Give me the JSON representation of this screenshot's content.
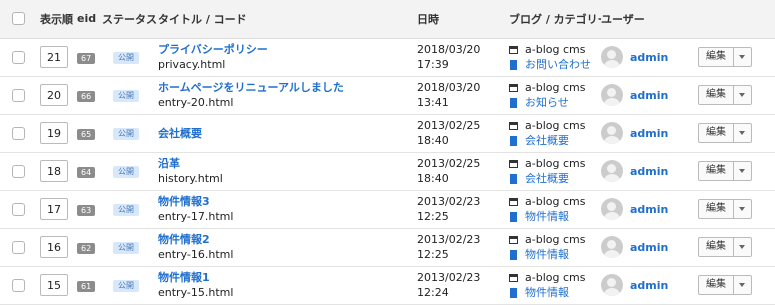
{
  "headers": {
    "order": "表示順",
    "eid": "eid",
    "status": "ステータス",
    "title": "タイトル / コード",
    "date": "日時",
    "blog": "ブログ / カテゴリー",
    "user": "ユーザー"
  },
  "rows": [
    {
      "order": "21",
      "eid": "67",
      "status": "公開",
      "title": "プライバシーポリシー",
      "code": "privacy.html",
      "date": "2018/03/20",
      "time": "17:39",
      "blog": "a-blog cms",
      "category": "お問い合わせ",
      "user": "admin",
      "edit": "編集"
    },
    {
      "order": "20",
      "eid": "66",
      "status": "公開",
      "title": "ホームページをリニューアルしました",
      "code": "entry-20.html",
      "date": "2018/03/20",
      "time": "13:41",
      "blog": "a-blog cms",
      "category": "お知らせ",
      "user": "admin",
      "edit": "編集"
    },
    {
      "order": "19",
      "eid": "65",
      "status": "公開",
      "title": "会社概要",
      "code": "",
      "date": "2013/02/25",
      "time": "18:40",
      "blog": "a-blog cms",
      "category": "会社概要",
      "user": "admin",
      "edit": "編集"
    },
    {
      "order": "18",
      "eid": "64",
      "status": "公開",
      "title": "沿革",
      "code": "history.html",
      "date": "2013/02/25",
      "time": "18:40",
      "blog": "a-blog cms",
      "category": "会社概要",
      "user": "admin",
      "edit": "編集"
    },
    {
      "order": "17",
      "eid": "63",
      "status": "公開",
      "title": "物件情報3",
      "code": "entry-17.html",
      "date": "2013/02/23",
      "time": "12:25",
      "blog": "a-blog cms",
      "category": "物件情報",
      "user": "admin",
      "edit": "編集"
    },
    {
      "order": "16",
      "eid": "62",
      "status": "公開",
      "title": "物件情報2",
      "code": "entry-16.html",
      "date": "2013/02/23",
      "time": "12:25",
      "blog": "a-blog cms",
      "category": "物件情報",
      "user": "admin",
      "edit": "編集"
    },
    {
      "order": "15",
      "eid": "61",
      "status": "公開",
      "title": "物件情報1",
      "code": "entry-15.html",
      "date": "2013/02/23",
      "time": "12:24",
      "blog": "a-blog cms",
      "category": "物件情報",
      "user": "admin",
      "edit": "編集"
    }
  ]
}
